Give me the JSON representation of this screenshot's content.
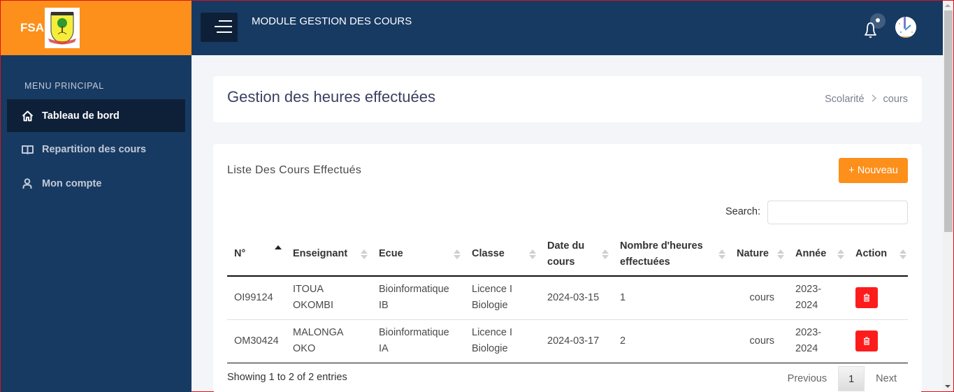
{
  "brand": {
    "name": "FSA",
    "logo_icon": "university-crest-icon",
    "color": "#fd8f1b"
  },
  "topbar": {
    "module_title": "MODULE GESTION DES COURS",
    "menu_icon": "hamburger-menu-icon",
    "notification_icon": "bell-icon",
    "avatar_icon": "user-avatar",
    "color": "#173a63"
  },
  "sidebar": {
    "section_title": "MENU PRINCIPAL",
    "items": [
      {
        "label": "Tableau de bord",
        "icon": "home-icon",
        "active": true
      },
      {
        "label": "Repartition des cours",
        "icon": "book-open-icon",
        "active": false
      },
      {
        "label": "Mon compte",
        "icon": "user-icon",
        "active": false
      }
    ]
  },
  "header": {
    "title": "Gestion des heures effectuées",
    "breadcrumb": [
      "Scolarité",
      "cours"
    ]
  },
  "list": {
    "title": "Liste Des Cours Effectués",
    "new_button": "+ Nouveau",
    "search_label": "Search:",
    "search_value": "",
    "columns": [
      {
        "label": "N°",
        "sort": "asc"
      },
      {
        "label": "Enseignant",
        "sort": "none"
      },
      {
        "label": "Ecue",
        "sort": "none"
      },
      {
        "label": "Classe",
        "sort": "none"
      },
      {
        "label": "Date du cours",
        "sort": "none"
      },
      {
        "label": "Nombre d'heures effectuées",
        "sort": "none"
      },
      {
        "label": "Nature",
        "sort": "none"
      },
      {
        "label": "Année",
        "sort": "none"
      },
      {
        "label": "Action",
        "sort": "none"
      }
    ],
    "rows": [
      {
        "numero": "OI99124",
        "enseignant": "ITOUA OKOMBI",
        "ecue": "Bioinformatique IB",
        "classe": "Licence I Biologie",
        "date": "2024-03-15",
        "heures": "1",
        "nature": "cours",
        "annee": "2023-2024",
        "action_icon": "trash-icon"
      },
      {
        "numero": "OM30424",
        "enseignant": "MALONGA OKO",
        "ecue": "Bioinformatique IA",
        "classe": "Licence I Biologie",
        "date": "2024-03-17",
        "heures": "2",
        "nature": "cours",
        "annee": "2023-2024",
        "action_icon": "trash-icon"
      }
    ],
    "info": "Showing 1 to 2 of 2 entries",
    "pagination": {
      "previous": "Previous",
      "current": "1",
      "next": "Next"
    }
  },
  "colors": {
    "accent": "#fd8f1b",
    "navy": "#173a63",
    "navy_dark": "#0e2038",
    "danger": "#fc1c1c"
  }
}
